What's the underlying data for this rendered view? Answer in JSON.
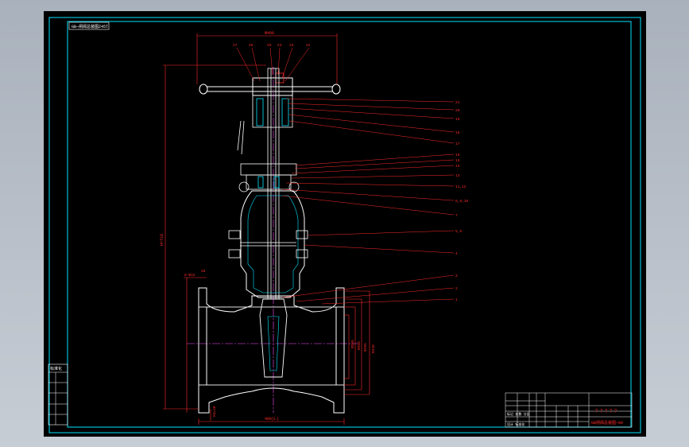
{
  "title_label": "GB—闸阀总装图Z45T",
  "dimensions": {
    "top_width": "Φ400",
    "bottom_width": "400(L)",
    "overall_height": "H=718",
    "bottom_height": "H1=40",
    "flange_dia_1": "Φ340",
    "flange_dia_2": "Φ295",
    "flange_dia_3": "Φ250",
    "flange_dia_4": "Φ200",
    "flange_mark": "8-Φ22",
    "flange_thickness": "28"
  },
  "top_callouts": [
    "27",
    "26",
    "25",
    "24",
    "23",
    "22"
  ],
  "right_callouts": [
    "21",
    "20",
    "19",
    "18",
    "17",
    "16",
    "15",
    "14",
    "13",
    "11,12",
    "8,9,10",
    "7",
    "5,6",
    "4",
    "3",
    "2",
    "1"
  ],
  "left_strip": {
    "header": "标准化",
    "rows": [
      "",
      "",
      "",
      "",
      ""
    ]
  },
  "title_block": {
    "title": "？？？？？",
    "drawing_no": "GB闸阀总装图—00",
    "rows": [
      "标记 处数 分区",
      "设计 标准化"
    ]
  },
  "colors": {
    "frame": "#00e5ff",
    "part": "#ffffff",
    "dim": "#ff2a2a",
    "center": "#ff4dff",
    "body": "#e0e0e0"
  }
}
